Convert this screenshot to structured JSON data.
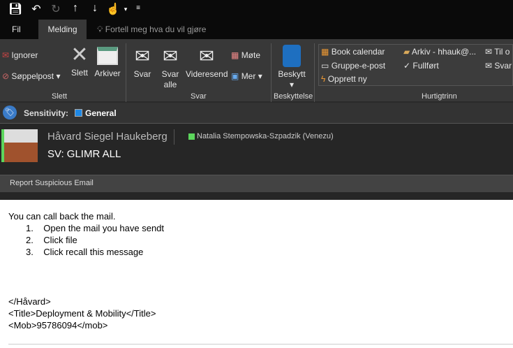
{
  "qat": {
    "icons": [
      "save-icon",
      "undo-icon",
      "redo-icon",
      "up-icon",
      "down-icon",
      "touch-mode-icon",
      "customize-icon"
    ]
  },
  "tabs": {
    "file": "Fil",
    "message": "Melding",
    "tell_me": "Fortell meg hva du vil gjøre"
  },
  "ribbon": {
    "delete_group": {
      "label": "Slett",
      "ignore": "Ignorer",
      "junk": "Søppelpost",
      "delete": "Slett",
      "archive": "Arkiver"
    },
    "respond_group": {
      "label": "Svar",
      "reply": "Svar",
      "reply_all_1": "Svar",
      "reply_all_2": "alle",
      "forward": "Videresend",
      "meeting": "Møte",
      "more": "Mer"
    },
    "protect_group": {
      "label": "Beskyttelse",
      "protect": "Beskytt"
    },
    "quick_steps": {
      "label": "Hurtigtrinn",
      "items": [
        "Book calendar",
        "Gruppe-e-post",
        "Opprett ny",
        "Arkiv - hhauk@...",
        "Fullført",
        "Til o",
        "Svar"
      ]
    }
  },
  "sensitivity": {
    "label": "Sensitivity:",
    "value": "General",
    "color": "#1e88e5"
  },
  "header": {
    "sender": "Håvard Siegel Haukeberg",
    "recipient": "Natalia Stempowska-Szpadzik (Venezu)",
    "subject": "SV: GLIMR ALL",
    "presence_color": "#5cd65c"
  },
  "report_bar": "Report Suspicious Email",
  "body": {
    "intro": "You can call back the mail.",
    "steps": [
      "Open the mail you have sendt",
      "Click file",
      "Click recall this message"
    ],
    "sig": [
      "</Håvard>",
      "<Title>Deployment & Mobility</Title>",
      "<Mob>95786094</mob>"
    ]
  }
}
